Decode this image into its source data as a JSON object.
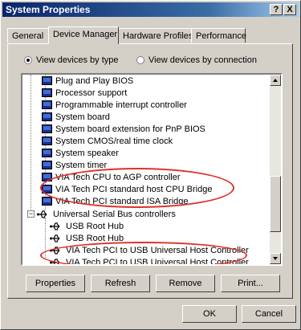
{
  "window": {
    "title": "System Properties",
    "help_glyph": "?",
    "close_glyph": "X"
  },
  "tabs": [
    "General",
    "Device Manager",
    "Hardware Profiles",
    "Performance"
  ],
  "view_options": {
    "by_type": "View devices by type",
    "by_connection": "View devices by connection",
    "selected": "by_type"
  },
  "tree": {
    "items": [
      "Plug and Play BIOS",
      "Processor support",
      "Programmable interrupt controller",
      "System board",
      "System board extension for PnP BIOS",
      "System CMOS/real time clock",
      "System speaker",
      "System timer",
      "VIA Tech CPU to AGP controller",
      "VIA Tech PCI standard host CPU Bridge",
      "VIA Tech PCI standard ISA Bridge"
    ],
    "usb_category": "Universal Serial Bus controllers",
    "usb_items": [
      "USB Root Hub",
      "USB Root Hub",
      "VIA Tech PCI to USB Universal Host Controller",
      "VIA Tech PCI to USB Universal Host Controller"
    ],
    "expand_glyph": "−"
  },
  "buttons": {
    "properties": "Properties",
    "refresh": "Refresh",
    "remove": "Remove",
    "print": "Print...",
    "ok": "OK",
    "cancel": "Cancel"
  },
  "colors": {
    "highlight_ellipse": "#e0302a",
    "titlebar": "#0a246a"
  }
}
